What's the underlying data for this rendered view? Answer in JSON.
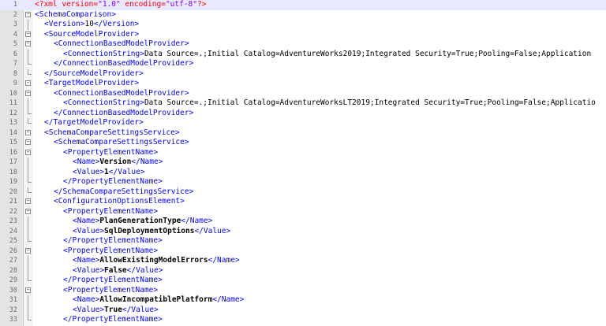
{
  "lines": [
    {
      "n": "1",
      "indent": 0,
      "fold": "none",
      "kind": "decl",
      "open": "<?xml",
      "attr1": "version=",
      "val1": "\"1.0\"",
      "attr2": "encoding=",
      "val2": "\"utf-8\"",
      "close": "?>"
    },
    {
      "n": "2",
      "indent": 0,
      "fold": "open",
      "kind": "tag",
      "tag": "<SchemaComparison>"
    },
    {
      "n": "3",
      "indent": 1,
      "fold": "line",
      "kind": "elem",
      "open": "<Version>",
      "text": "10",
      "close": "</Version>",
      "bold": false
    },
    {
      "n": "4",
      "indent": 1,
      "fold": "open",
      "kind": "tag",
      "tag": "<SourceModelProvider>"
    },
    {
      "n": "5",
      "indent": 2,
      "fold": "open",
      "kind": "tag",
      "tag": "<ConnectionBasedModelProvider>"
    },
    {
      "n": "6",
      "indent": 3,
      "fold": "line",
      "kind": "elem",
      "open": "<ConnectionString>",
      "text": "Data Source=.;Initial Catalog=AdventureWorks2019;Integrated Security=True;Pooling=False;Application",
      "close": "",
      "bold": false
    },
    {
      "n": "7",
      "indent": 2,
      "fold": "end",
      "kind": "tag",
      "tag": "</ConnectionBasedModelProvider>"
    },
    {
      "n": "8",
      "indent": 1,
      "fold": "end",
      "kind": "tag",
      "tag": "</SourceModelProvider>"
    },
    {
      "n": "9",
      "indent": 1,
      "fold": "open",
      "kind": "tag",
      "tag": "<TargetModelProvider>"
    },
    {
      "n": "10",
      "indent": 2,
      "fold": "open",
      "kind": "tag",
      "tag": "<ConnectionBasedModelProvider>"
    },
    {
      "n": "11",
      "indent": 3,
      "fold": "line",
      "kind": "elem",
      "open": "<ConnectionString>",
      "text": "Data Source=.;Initial Catalog=AdventureWorksLT2019;Integrated Security=True;Pooling=False;Applicatio",
      "close": "",
      "bold": false
    },
    {
      "n": "12",
      "indent": 2,
      "fold": "end",
      "kind": "tag",
      "tag": "</ConnectionBasedModelProvider>"
    },
    {
      "n": "13",
      "indent": 1,
      "fold": "end",
      "kind": "tag",
      "tag": "</TargetModelProvider>"
    },
    {
      "n": "14",
      "indent": 1,
      "fold": "open",
      "kind": "tag",
      "tag": "<SchemaCompareSettingsService>"
    },
    {
      "n": "15",
      "indent": 2,
      "fold": "open",
      "kind": "tag",
      "tag": "<SchemaCompareSettingsService>"
    },
    {
      "n": "16",
      "indent": 3,
      "fold": "open",
      "kind": "tag",
      "tag": "<PropertyElementName>"
    },
    {
      "n": "17",
      "indent": 4,
      "fold": "line",
      "kind": "elem",
      "open": "<Name>",
      "text": "Version",
      "close": "</Name>",
      "bold": true
    },
    {
      "n": "18",
      "indent": 4,
      "fold": "line",
      "kind": "elem",
      "open": "<Value>",
      "text": "1",
      "close": "</Value>",
      "bold": true
    },
    {
      "n": "19",
      "indent": 3,
      "fold": "end",
      "kind": "tag",
      "tag": "</PropertyElementName>"
    },
    {
      "n": "20",
      "indent": 2,
      "fold": "end",
      "kind": "tag",
      "tag": "</SchemaCompareSettingsService>"
    },
    {
      "n": "21",
      "indent": 2,
      "fold": "open",
      "kind": "tag",
      "tag": "<ConfigurationOptionsElement>"
    },
    {
      "n": "22",
      "indent": 3,
      "fold": "open",
      "kind": "tag",
      "tag": "<PropertyElementName>"
    },
    {
      "n": "23",
      "indent": 4,
      "fold": "line",
      "kind": "elem",
      "open": "<Name>",
      "text": "PlanGenerationType",
      "close": "</Name>",
      "bold": true
    },
    {
      "n": "24",
      "indent": 4,
      "fold": "line",
      "kind": "elem",
      "open": "<Value>",
      "text": "SqlDeploymentOptions",
      "close": "</Value>",
      "bold": true
    },
    {
      "n": "25",
      "indent": 3,
      "fold": "end",
      "kind": "tag",
      "tag": "</PropertyElementName>"
    },
    {
      "n": "26",
      "indent": 3,
      "fold": "open",
      "kind": "tag",
      "tag": "<PropertyElementName>"
    },
    {
      "n": "27",
      "indent": 4,
      "fold": "line",
      "kind": "elem",
      "open": "<Name>",
      "text": "AllowExistingModelErrors",
      "close": "</Name>",
      "bold": true
    },
    {
      "n": "28",
      "indent": 4,
      "fold": "line",
      "kind": "elem",
      "open": "<Value>",
      "text": "False",
      "close": "</Value>",
      "bold": true
    },
    {
      "n": "29",
      "indent": 3,
      "fold": "end",
      "kind": "tag",
      "tag": "</PropertyElementName>"
    },
    {
      "n": "30",
      "indent": 3,
      "fold": "open",
      "kind": "tag",
      "tag": "<PropertyElementName>"
    },
    {
      "n": "31",
      "indent": 4,
      "fold": "line",
      "kind": "elem",
      "open": "<Name>",
      "text": "AllowIncompatiblePlatform",
      "close": "</Name>",
      "bold": true
    },
    {
      "n": "32",
      "indent": 4,
      "fold": "line",
      "kind": "elem",
      "open": "<Value>",
      "text": "True",
      "close": "</Value>",
      "bold": true
    },
    {
      "n": "33",
      "indent": 3,
      "fold": "end",
      "kind": "tag",
      "tag": "</PropertyElementName>"
    }
  ]
}
